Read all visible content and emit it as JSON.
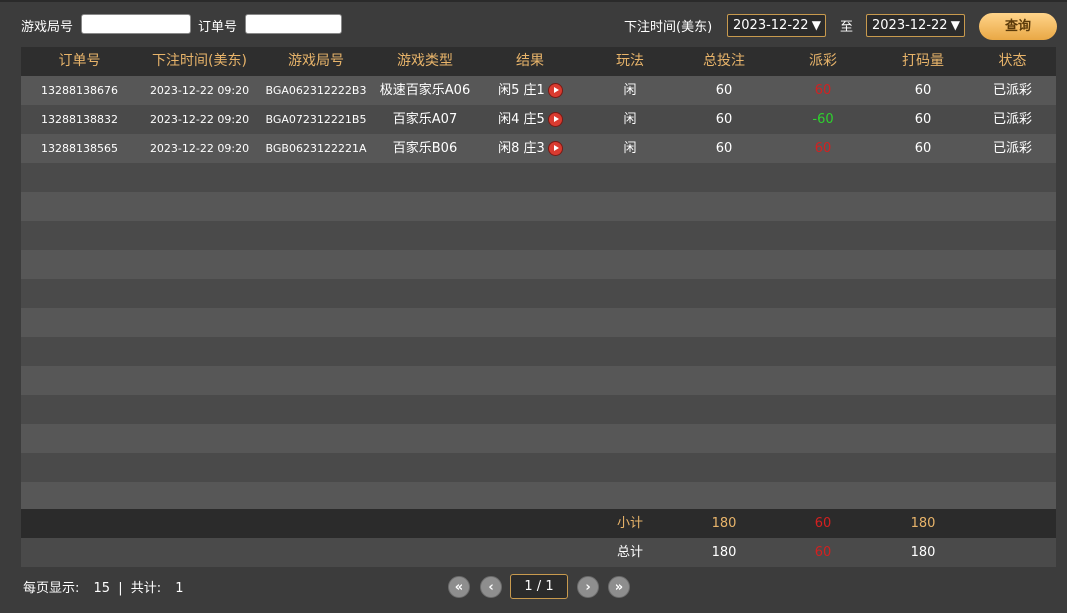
{
  "filters": {
    "round_label": "游戏局号",
    "round_value": "",
    "order_label": "订单号",
    "order_value": "",
    "time_label": "下注时间(美东)",
    "date_from": "2023-12-22",
    "to_label": "至",
    "date_to": "2023-12-22",
    "query_label": "查询"
  },
  "table": {
    "headers": [
      "订单号",
      "下注时间(美东)",
      "游戏局号",
      "游戏类型",
      "结果",
      "玩法",
      "总投注",
      "派彩",
      "打码量",
      "状态"
    ],
    "rows": [
      {
        "order": "13288138676",
        "time": "2023-12-22 09:20",
        "round": "BGA062312222B3",
        "game": "极速百家乐A06",
        "result": "闲5 庄1",
        "play": "闲",
        "bet": "60",
        "payout": "60",
        "payout_color": "red",
        "turnover": "60",
        "status": "已派彩"
      },
      {
        "order": "13288138832",
        "time": "2023-12-22 09:20",
        "round": "BGA072312221B5",
        "game": "百家乐A07",
        "result": "闲4 庄5",
        "play": "闲",
        "bet": "60",
        "payout": "-60",
        "payout_color": "green",
        "turnover": "60",
        "status": "已派彩"
      },
      {
        "order": "13288138565",
        "time": "2023-12-22 09:20",
        "round": "BGB0623122221A",
        "game": "百家乐B06",
        "result": "闲8 庄3",
        "play": "闲",
        "bet": "60",
        "payout": "60",
        "payout_color": "red",
        "turnover": "60",
        "status": "已派彩"
      }
    ],
    "subtotal": {
      "label": "小计",
      "bet": "180",
      "payout": "60",
      "turnover": "180"
    },
    "total": {
      "label": "总计",
      "bet": "180",
      "payout": "60",
      "turnover": "180"
    }
  },
  "pager": {
    "per_page_label": "每页显示:",
    "per_page": "15",
    "separator": "|",
    "count_label": "共计:",
    "count": "1",
    "page_display": "1 / 1",
    "first_icon": "double-chevron-left-icon",
    "prev_icon": "chevron-left-icon",
    "next_icon": "chevron-right-icon",
    "last_icon": "double-chevron-right-icon"
  },
  "colors": {
    "accent": "#e8b46a",
    "payout_red": "#d42020",
    "payout_green": "#2ed12e",
    "button": "#f0b95a"
  }
}
